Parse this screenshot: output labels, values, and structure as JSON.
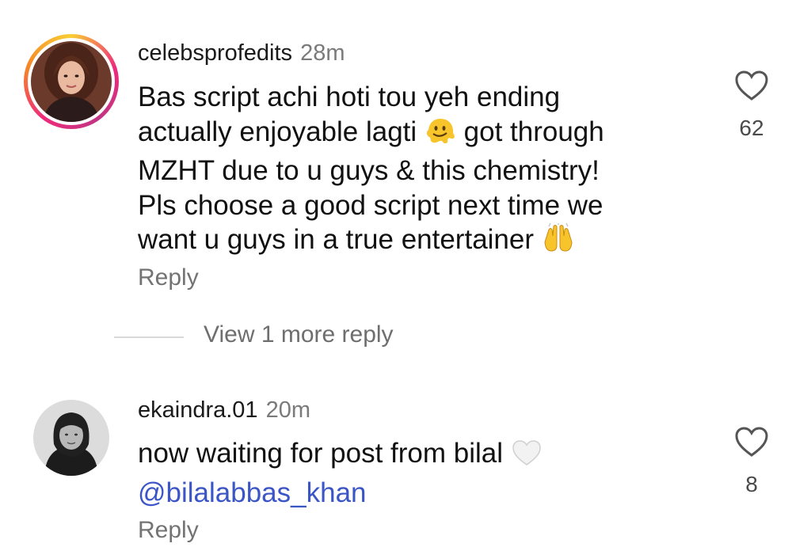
{
  "comments": [
    {
      "username": "celebsprofedits",
      "time": "28m",
      "text_lines": [
        "Bas script achi hoti tou yeh ending",
        "actually enjoyable lagti",
        "got through",
        "MZHT due to u guys & this chemistry!",
        "Pls choose a good script next time we",
        "want u guys in a true entertainer"
      ],
      "emoji_1": "melting-face",
      "emoji_2": "raising-hands",
      "likes": "62",
      "reply_label": "Reply"
    },
    {
      "username": "ekaindra.01",
      "time": "20m",
      "text": "now waiting for post from bilal",
      "mention": "@bilalabbas_khan",
      "emoji": "white-heart",
      "likes": "8",
      "reply_label": "Reply"
    }
  ],
  "view_more_label": "View 1 more reply",
  "colors": {
    "mention": "#3b55c7",
    "secondary": "#737373"
  }
}
